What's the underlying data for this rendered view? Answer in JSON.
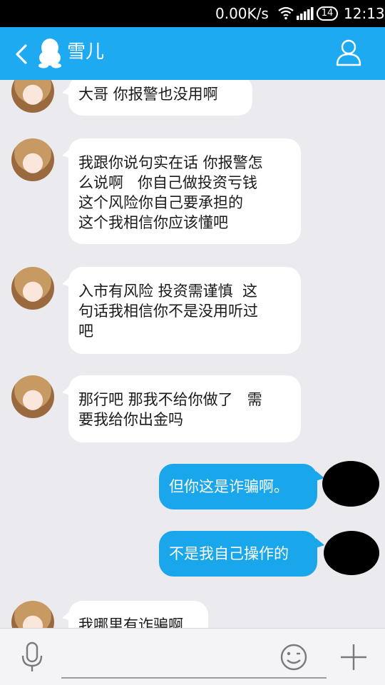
{
  "status_bar": {
    "network_speed": "0.00K/s",
    "badge": "14",
    "time": "12:13"
  },
  "header": {
    "title": "雪儿"
  },
  "messages": [
    {
      "side": "left",
      "text": "大哥 你报警也没用啊"
    },
    {
      "side": "left",
      "text": "我跟你说句实在话 你报警怎\n么说啊   你自己做投资亏钱\n这个风险你自己要承担的\n这个我相信你应该懂吧"
    },
    {
      "side": "left",
      "text": "入市有风险 投资需谨慎  这\n句话我相信你不是没用听过\n吧"
    },
    {
      "side": "left",
      "text": "那行吧 那我不给你做了   需\n要我给你出金吗"
    },
    {
      "side": "right",
      "text": "但你这是诈骗啊。"
    },
    {
      "side": "right",
      "text": "不是我自己操作的"
    },
    {
      "side": "left",
      "text": "我哪里有诈骗啊"
    }
  ],
  "input": {
    "placeholder": ""
  },
  "icons": {
    "back": "back-arrow-icon",
    "qq": "qq-penguin-icon",
    "contact": "contact-profile-icon",
    "mic": "microphone-icon",
    "emoji": "emoji-icon",
    "plus": "plus-icon"
  },
  "colors": {
    "header": "#1eaaf1",
    "sent_bubble": "#1aa6ea",
    "received_bubble": "#ffffff",
    "background": "#ebebef"
  }
}
